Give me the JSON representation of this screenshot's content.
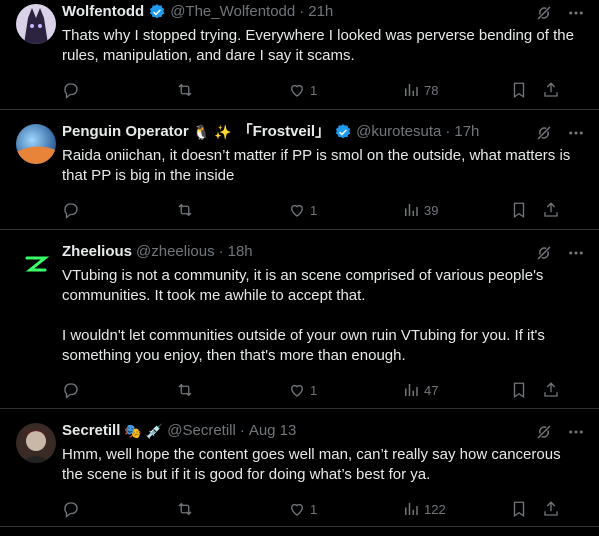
{
  "posts": [
    {
      "name": "Wolfentodd",
      "verified": true,
      "handle": "@The_Wolfentodd",
      "time": "21h",
      "paragraphs": [
        "Thats why I stopped trying. Everywhere I looked was perverse bending of the rules, manipulation, and dare I say it scams."
      ],
      "likes": "1",
      "views": "78",
      "replies": "",
      "reposts": ""
    },
    {
      "name": "Penguin Operator",
      "name_suffix": "「Frostveil」",
      "verified": true,
      "handle": "@kurotesuta",
      "time": "17h",
      "paragraphs": [
        "Raida oniichan, it doesn’t matter if PP is smol on the outside, what matters is that PP is big in the inside"
      ],
      "likes": "1",
      "views": "39",
      "replies": "",
      "reposts": ""
    },
    {
      "name": "Zheelious",
      "verified": false,
      "handle": "@zheelious",
      "time": "18h",
      "paragraphs": [
        "VTubing is not a community, it is an scene comprised of various people's communities. It took me awhile to accept that.",
        "I wouldn't let communities outside of your own ruin VTubing for you. If it's something you enjoy, then that's more than enough."
      ],
      "likes": "1",
      "views": "47",
      "replies": "",
      "reposts": ""
    },
    {
      "name": "Secretill",
      "verified": false,
      "handle": "@Secretill",
      "time": "Aug 13",
      "paragraphs": [
        "Hmm, well hope the content goes well man, can’t really say how cancerous the scene is but if it is good for doing what’s best for ya."
      ],
      "likes": "1",
      "views": "122",
      "replies": "",
      "reposts": ""
    }
  ],
  "separator": "·",
  "colors": {
    "background": "#000000",
    "text": "#e7e9ea",
    "muted": "#71767b",
    "verified": "#1d9bf0",
    "border": "#2f3336"
  },
  "icons": [
    "grok-icon",
    "more-icon",
    "reply-icon",
    "repost-icon",
    "like-icon",
    "views-icon",
    "bookmark-icon",
    "share-icon",
    "verified-badge-icon"
  ]
}
